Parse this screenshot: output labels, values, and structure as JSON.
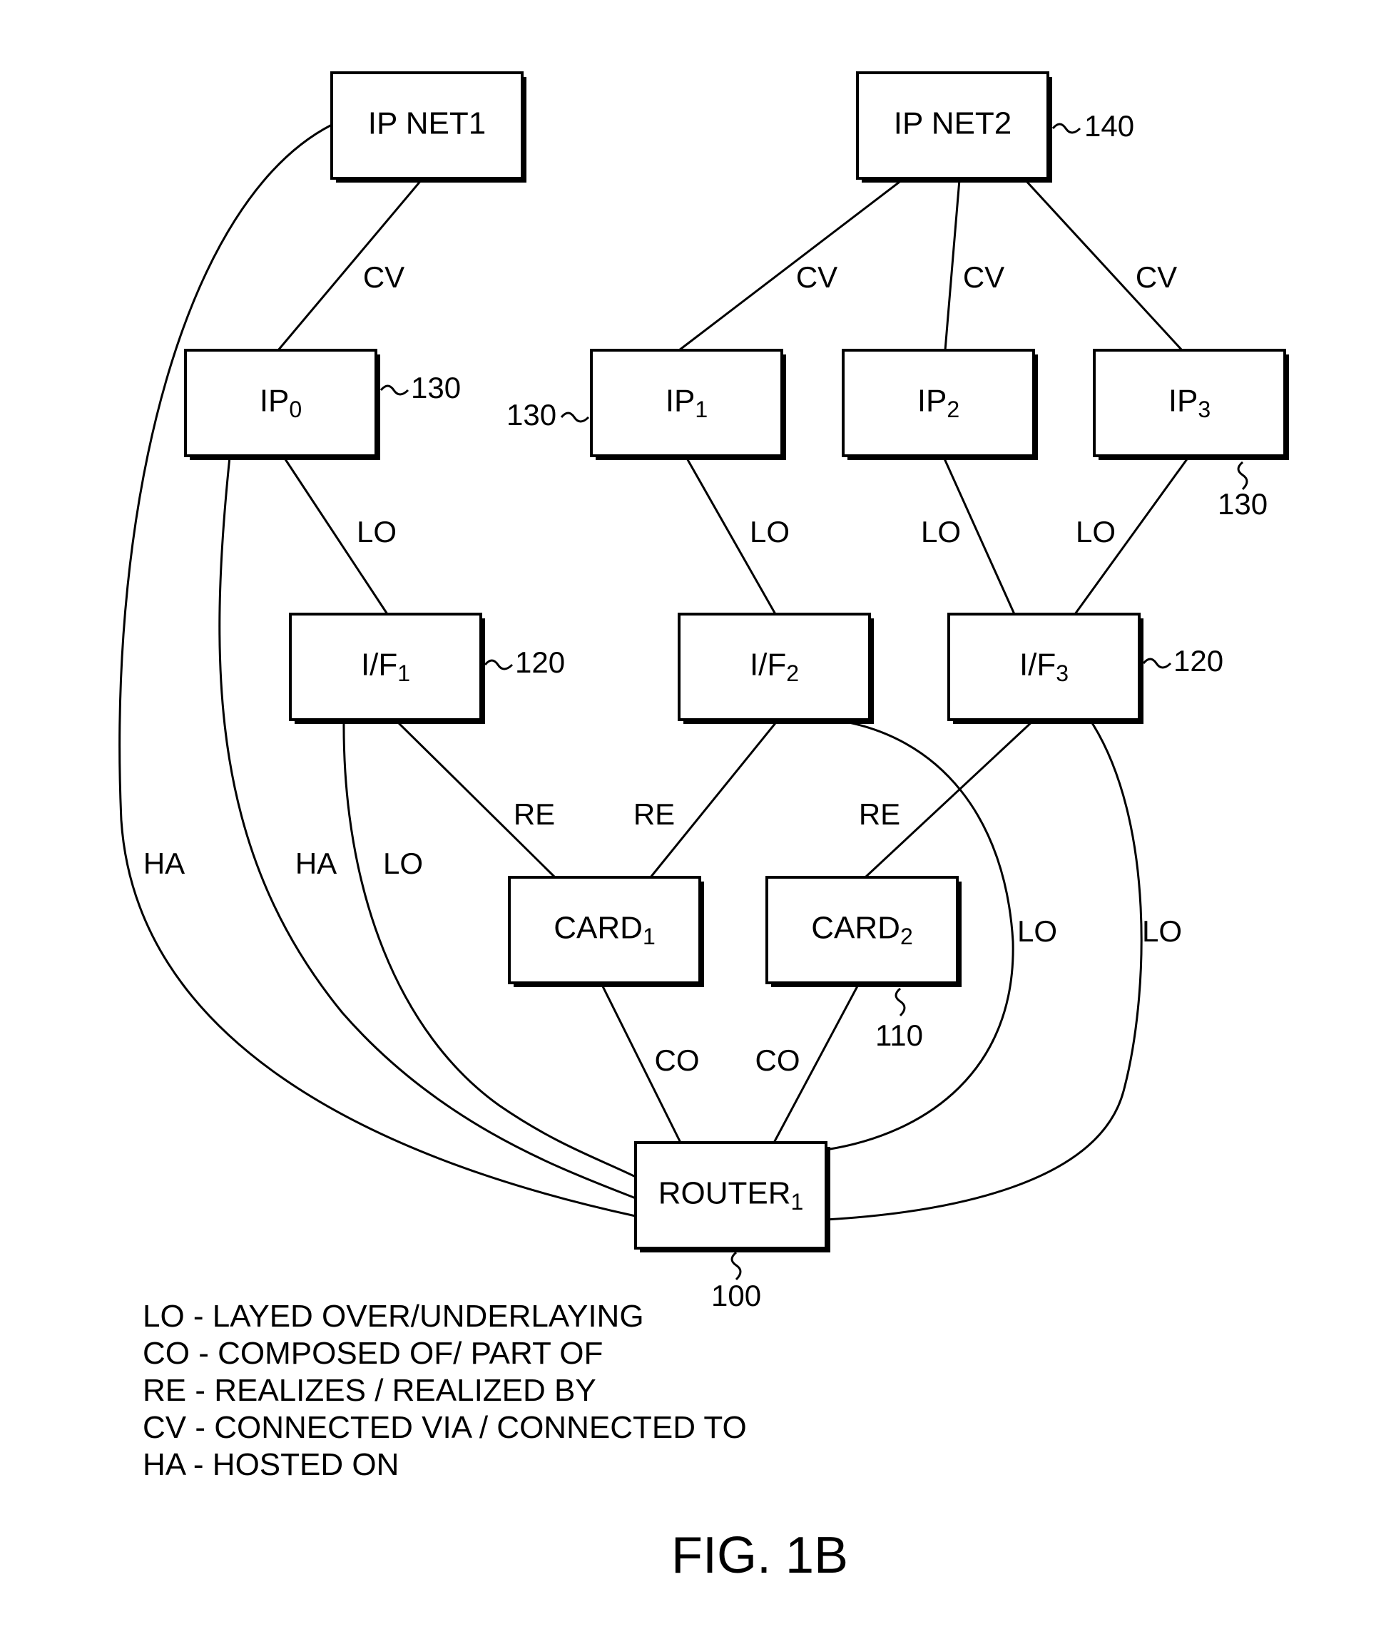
{
  "figure": {
    "title": "FIG. 1B",
    "nodes": [
      {
        "id": "ipnet1",
        "label": "IP NET1",
        "sub": ""
      },
      {
        "id": "ipnet2",
        "label": "IP NET2",
        "sub": "",
        "ref": "140"
      },
      {
        "id": "ip0",
        "label": "IP",
        "sub": "0",
        "ref": "130"
      },
      {
        "id": "ip1",
        "label": "IP",
        "sub": "1",
        "ref": "130"
      },
      {
        "id": "ip2",
        "label": "IP",
        "sub": "2"
      },
      {
        "id": "ip3",
        "label": "IP",
        "sub": "3",
        "ref": "130"
      },
      {
        "id": "if1",
        "label": "I/F",
        "sub": "1",
        "ref": "120"
      },
      {
        "id": "if2",
        "label": "I/F",
        "sub": "2"
      },
      {
        "id": "if3",
        "label": "I/F",
        "sub": "3",
        "ref": "120"
      },
      {
        "id": "card1",
        "label": "CARD",
        "sub": "1"
      },
      {
        "id": "card2",
        "label": "CARD",
        "sub": "2",
        "ref": "110"
      },
      {
        "id": "router1",
        "label": "ROUTER",
        "sub": "1",
        "ref": "100"
      }
    ],
    "edges": [
      {
        "from": "ipnet1",
        "to": "ip0",
        "label": "CV"
      },
      {
        "from": "ipnet2",
        "to": "ip1",
        "label": "CV"
      },
      {
        "from": "ipnet2",
        "to": "ip2",
        "label": "CV"
      },
      {
        "from": "ipnet2",
        "to": "ip3",
        "label": "CV"
      },
      {
        "from": "ip0",
        "to": "if1",
        "label": "LO"
      },
      {
        "from": "ip1",
        "to": "if2",
        "label": "LO"
      },
      {
        "from": "ip2",
        "to": "if3",
        "label": "LO"
      },
      {
        "from": "ip3",
        "to": "if3",
        "label": "LO"
      },
      {
        "from": "if1",
        "to": "card1",
        "label": "RE"
      },
      {
        "from": "if2",
        "to": "card1",
        "label": "RE"
      },
      {
        "from": "if3",
        "to": "card2",
        "label": "RE"
      },
      {
        "from": "card1",
        "to": "router1",
        "label": "CO"
      },
      {
        "from": "card2",
        "to": "router1",
        "label": "CO"
      },
      {
        "from": "ipnet1",
        "to": "router1",
        "label": "HA"
      },
      {
        "from": "ip0",
        "to": "router1",
        "label": "HA"
      },
      {
        "from": "if1",
        "to": "router1",
        "label": "LO"
      },
      {
        "from": "if2",
        "to": "router1",
        "label": "LO"
      },
      {
        "from": "if3",
        "to": "router1",
        "label": "LO"
      }
    ],
    "legend": [
      "LO - LAYED OVER/UNDERLAYING",
      "CO - COMPOSED OF/ PART OF",
      "RE - REALIZES / REALIZED BY",
      "CV - CONNECTED VIA / CONNECTED TO",
      "HA - HOSTED ON"
    ]
  }
}
